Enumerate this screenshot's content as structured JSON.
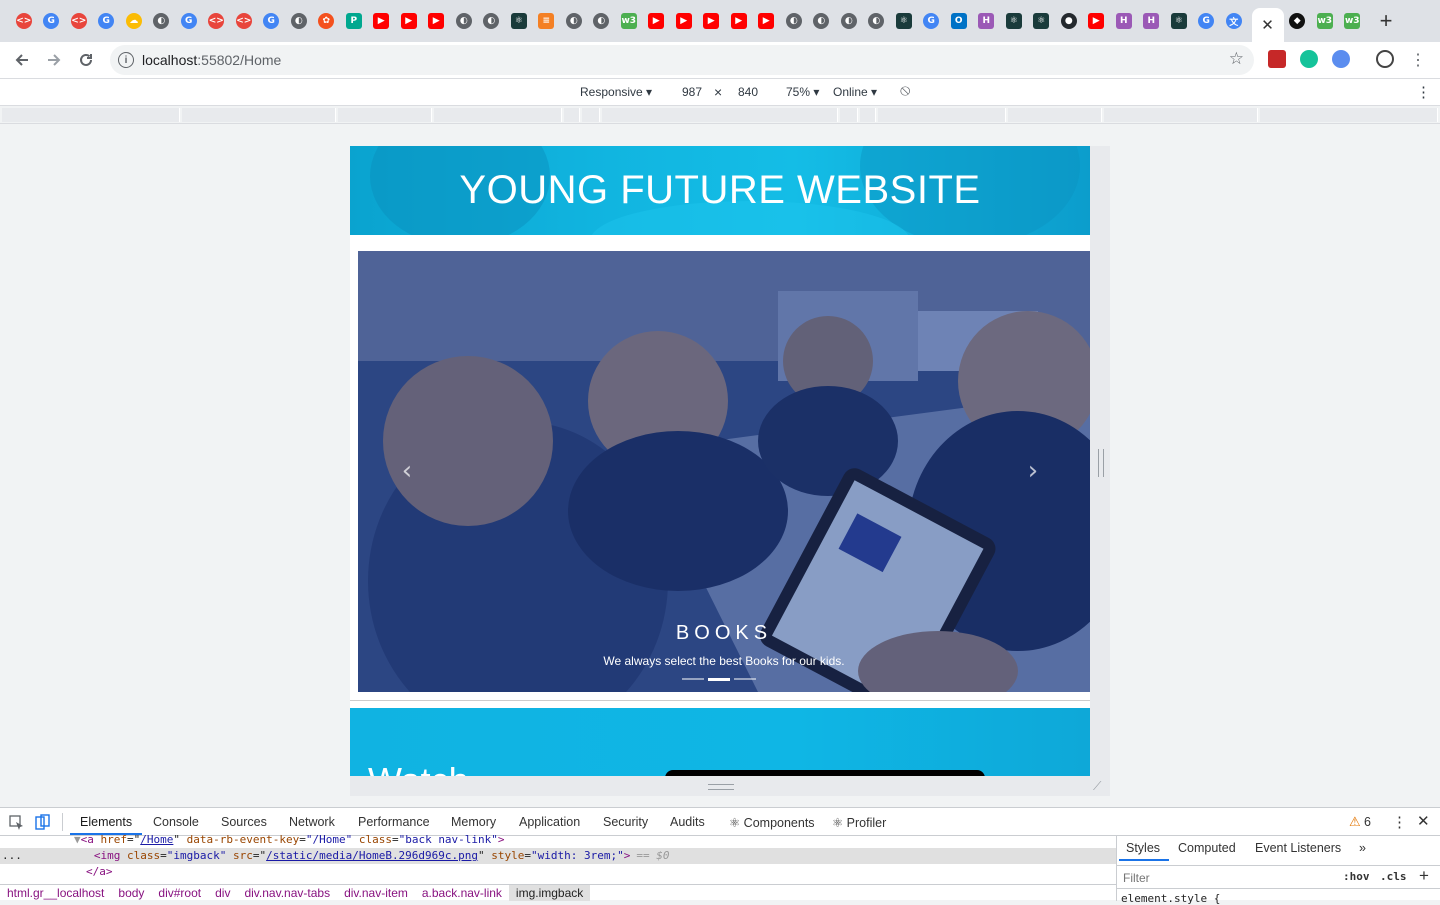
{
  "browser": {
    "active_tab_close": "✕",
    "new_tab": "+",
    "url_host": "localhost",
    "url_rest": ":55802/Home",
    "tab_favicons": [
      {
        "icon": "code-icon",
        "color": "#e8453c",
        "glyph": "<>"
      },
      {
        "icon": "google-icon",
        "color": "#4285f4",
        "glyph": "G"
      },
      {
        "icon": "code-icon",
        "color": "#e8453c",
        "glyph": "<>"
      },
      {
        "icon": "google-icon",
        "color": "#4285f4",
        "glyph": "G"
      },
      {
        "icon": "cloud-icon",
        "color": "#fbbc05",
        "glyph": "☁"
      },
      {
        "icon": "globe-icon",
        "color": "#5f6368",
        "glyph": "◐"
      },
      {
        "icon": "google-icon",
        "color": "#4285f4",
        "glyph": "G"
      },
      {
        "icon": "code-icon",
        "color": "#e8453c",
        "glyph": "<>"
      },
      {
        "icon": "code-icon",
        "color": "#e8453c",
        "glyph": "<>"
      },
      {
        "icon": "google-icon",
        "color": "#4285f4",
        "glyph": "G"
      },
      {
        "icon": "globe-icon",
        "color": "#5f6368",
        "glyph": "◐"
      },
      {
        "icon": "flower-icon",
        "color": "#f4511e",
        "glyph": "✿"
      },
      {
        "icon": "pen-icon",
        "color": "#00a88f",
        "glyph": "P"
      },
      {
        "icon": "youtube-icon",
        "color": "#ff0000",
        "glyph": "▶"
      },
      {
        "icon": "youtube-icon",
        "color": "#ff0000",
        "glyph": "▶"
      },
      {
        "icon": "youtube-icon",
        "color": "#ff0000",
        "glyph": "▶"
      },
      {
        "icon": "globe-icon",
        "color": "#5f6368",
        "glyph": "◐"
      },
      {
        "icon": "globe-icon",
        "color": "#5f6368",
        "glyph": "◐"
      },
      {
        "icon": "react-icon",
        "color": "#1a3b3b",
        "glyph": "⚛"
      },
      {
        "icon": "stack-icon",
        "color": "#f48024",
        "glyph": "≡"
      },
      {
        "icon": "globe-icon",
        "color": "#5f6368",
        "glyph": "◐"
      },
      {
        "icon": "globe-icon",
        "color": "#5f6368",
        "glyph": "◐"
      },
      {
        "icon": "w3-icon",
        "color": "#4caf50",
        "glyph": "w3"
      },
      {
        "icon": "youtube-icon",
        "color": "#ff0000",
        "glyph": "▶"
      },
      {
        "icon": "youtube-icon",
        "color": "#ff0000",
        "glyph": "▶"
      },
      {
        "icon": "youtube-icon",
        "color": "#ff0000",
        "glyph": "▶"
      },
      {
        "icon": "youtube-icon",
        "color": "#ff0000",
        "glyph": "▶"
      },
      {
        "icon": "youtube-icon",
        "color": "#ff0000",
        "glyph": "▶"
      },
      {
        "icon": "globe-icon",
        "color": "#5f6368",
        "glyph": "◐"
      },
      {
        "icon": "globe-icon",
        "color": "#5f6368",
        "glyph": "◐"
      },
      {
        "icon": "globe-icon",
        "color": "#5f6368",
        "glyph": "◐"
      },
      {
        "icon": "globe-icon",
        "color": "#5f6368",
        "glyph": "◐"
      },
      {
        "icon": "react-icon",
        "color": "#1a3b3b",
        "glyph": "⚛"
      },
      {
        "icon": "google-icon",
        "color": "#4285f4",
        "glyph": "G"
      },
      {
        "icon": "outlook-icon",
        "color": "#0072c6",
        "glyph": "O"
      },
      {
        "icon": "h-icon",
        "color": "#9b59b6",
        "glyph": "H"
      },
      {
        "icon": "react-icon",
        "color": "#1a3b3b",
        "glyph": "⚛"
      },
      {
        "icon": "react-icon",
        "color": "#1a3b3b",
        "glyph": "⚛"
      },
      {
        "icon": "github-icon",
        "color": "#24292e",
        "glyph": "●"
      },
      {
        "icon": "youtube-icon",
        "color": "#ff0000",
        "glyph": "▶"
      },
      {
        "icon": "h-icon",
        "color": "#9b59b6",
        "glyph": "H"
      },
      {
        "icon": "h-icon",
        "color": "#9b59b6",
        "glyph": "H"
      },
      {
        "icon": "react-icon",
        "color": "#1a3b3b",
        "glyph": "⚛"
      },
      {
        "icon": "google-icon",
        "color": "#4285f4",
        "glyph": "G"
      },
      {
        "icon": "translate-icon",
        "color": "#4285f4",
        "glyph": "文"
      }
    ],
    "after_active_favicons": [
      {
        "icon": "codepen-icon",
        "color": "#111111",
        "glyph": "◆"
      },
      {
        "icon": "w3-icon",
        "color": "#4caf50",
        "glyph": "w3"
      },
      {
        "icon": "w3-icon",
        "color": "#4caf50",
        "glyph": "w3"
      }
    ]
  },
  "emulation": {
    "device": "Responsive ▾",
    "width": "987",
    "times": "×",
    "height": "840",
    "zoom": "75% ▾",
    "network": "Online ▾",
    "rotate": "⦸",
    "more": "⋮"
  },
  "site": {
    "title": "YOUNG FUTURE WEBSITE",
    "carousel": {
      "prev": "‹",
      "next": "›",
      "caption_title": "BOOKS",
      "caption_text": "We always select the best Books for our kids.",
      "slide_count": 3,
      "active_slide": 2
    },
    "watch_title": "Watch"
  },
  "devtools": {
    "tabs": [
      "Elements",
      "Console",
      "Sources",
      "Network",
      "Performance",
      "Memory",
      "Application",
      "Security",
      "Audits",
      "⚛ Components",
      "⚛ Profiler"
    ],
    "warnings": "6",
    "code": {
      "line1_arrow": "▼",
      "line1_open": "<a ",
      "line1_href_attr": "href",
      "line1_href_val": "/Home",
      "line1_key_attr": "data-rb-event-key",
      "line1_key_val": "\"/Home\"",
      "line1_class_attr": "class",
      "line1_class_val": "\"back nav-link\"",
      "line1_close": ">",
      "line2_dots": "...",
      "line2_open": "<img ",
      "line2_class_attr": "class",
      "line2_class_val": "\"imgback\"",
      "line2_src_attr": "src",
      "line2_src_val": "/static/media/HomeB.296d969c.png",
      "line2_style_attr": "style",
      "line2_style_val": "\"width: 3rem;\"",
      "line2_close": ">",
      "line2_eq": "== $0",
      "line3": "</a>"
    },
    "breadcrumbs": [
      "html.gr__localhost",
      "body",
      "div#root",
      "div",
      "div.nav.nav-tabs",
      "div.nav-item",
      "a.back.nav-link",
      "img.imgback"
    ],
    "styles_tabs": [
      "Styles",
      "Computed",
      "Event Listeners",
      "»"
    ],
    "filter_placeholder": "Filter",
    "hov": ":hov",
    "cls": ".cls",
    "add": "+",
    "element_style": "element.style {"
  }
}
